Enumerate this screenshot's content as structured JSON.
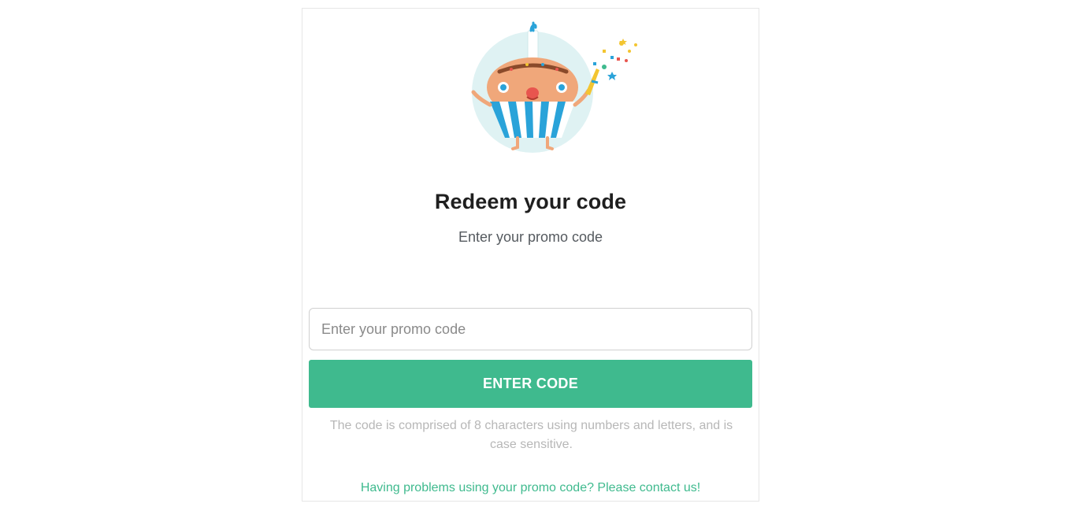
{
  "redeem": {
    "title": "Redeem your code",
    "subtitle": "Enter your promo code",
    "input_placeholder": "Enter your promo code",
    "input_value": "",
    "button_label": "ENTER CODE",
    "help_text": "The code is comprised of 8 characters using numbers and letters, and is case sensitive.",
    "contact_link": "Having problems using your promo code? Please contact us!"
  },
  "colors": {
    "accent": "#3fba8e",
    "title": "#1f1f1f",
    "subtitle": "#555a5f",
    "help": "#b7b7b7",
    "border": "#e6e6e6",
    "illustration_circle": "#dff2f3",
    "cupcake_blue": "#2aa3d9",
    "cupcake_face": "#f0a77a"
  },
  "icons": {
    "illustration": "cupcake-mascot-party-icon"
  }
}
